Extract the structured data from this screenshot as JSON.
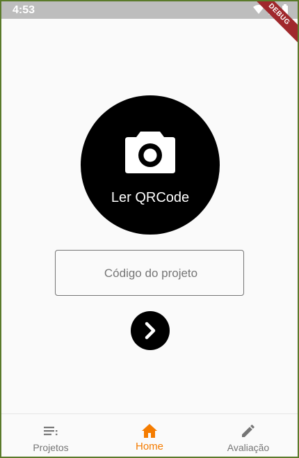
{
  "status_bar": {
    "time": "4:53",
    "debug_label": "DEBUG",
    "icons": [
      "wifi-icon",
      "signal-icon",
      "battery-icon"
    ]
  },
  "main": {
    "qr_button_label": "Ler QRCode",
    "qr_icon": "camera-icon",
    "code_input_placeholder": "Código do projeto",
    "code_input_value": "",
    "submit_icon": "chevron-right-icon"
  },
  "bottom_nav": {
    "items": [
      {
        "label": "Projetos",
        "icon": "list-icon",
        "active": false
      },
      {
        "label": "Home",
        "icon": "home-icon",
        "active": true
      },
      {
        "label": "Avaliação",
        "icon": "edit-pencil-icon",
        "active": false
      }
    ]
  },
  "colors": {
    "accent": "#f57c00",
    "inactive": "#757575",
    "button_bg": "#000000",
    "status_bar": "#bdbdbd",
    "debug_ribbon": "#a0282c"
  }
}
